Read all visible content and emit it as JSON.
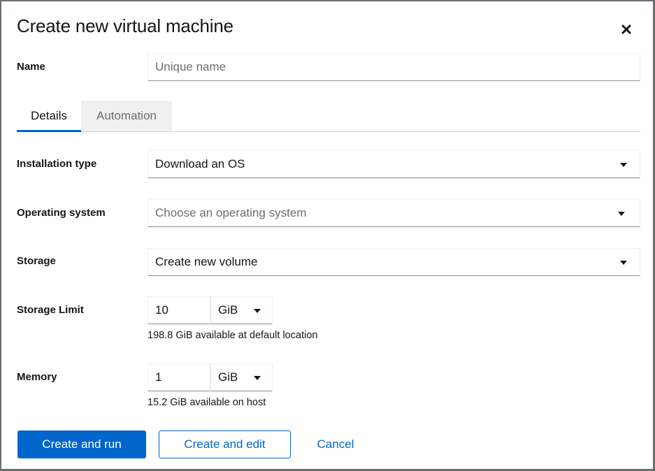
{
  "dialog": {
    "title": "Create new virtual machine",
    "close_icon": "close-icon"
  },
  "name_field": {
    "label": "Name",
    "value": "",
    "placeholder": "Unique name"
  },
  "tabs": [
    {
      "label": "Details",
      "active": true
    },
    {
      "label": "Automation",
      "active": false
    }
  ],
  "form": {
    "installation_type": {
      "label": "Installation type",
      "value": "Download an OS",
      "icon": "caret-down-icon"
    },
    "operating_system": {
      "label": "Operating system",
      "placeholder": "Choose an operating system",
      "icon": "caret-down-icon"
    },
    "storage": {
      "label": "Storage",
      "value": "Create new volume",
      "icon": "caret-down-icon"
    },
    "storage_limit": {
      "label": "Storage Limit",
      "value": "10",
      "unit": "GiB",
      "helper": "198.8 GiB available at default location"
    },
    "memory": {
      "label": "Memory",
      "value": "1",
      "unit": "GiB",
      "helper": "15.2 GiB available on host"
    }
  },
  "actions": {
    "create_and_run": "Create and run",
    "create_and_edit": "Create and edit",
    "cancel": "Cancel"
  },
  "colors": {
    "accent": "#0066cc",
    "text": "#151515",
    "placeholder": "#6a6e73",
    "tab_inactive_bg": "#f0f0f0"
  }
}
